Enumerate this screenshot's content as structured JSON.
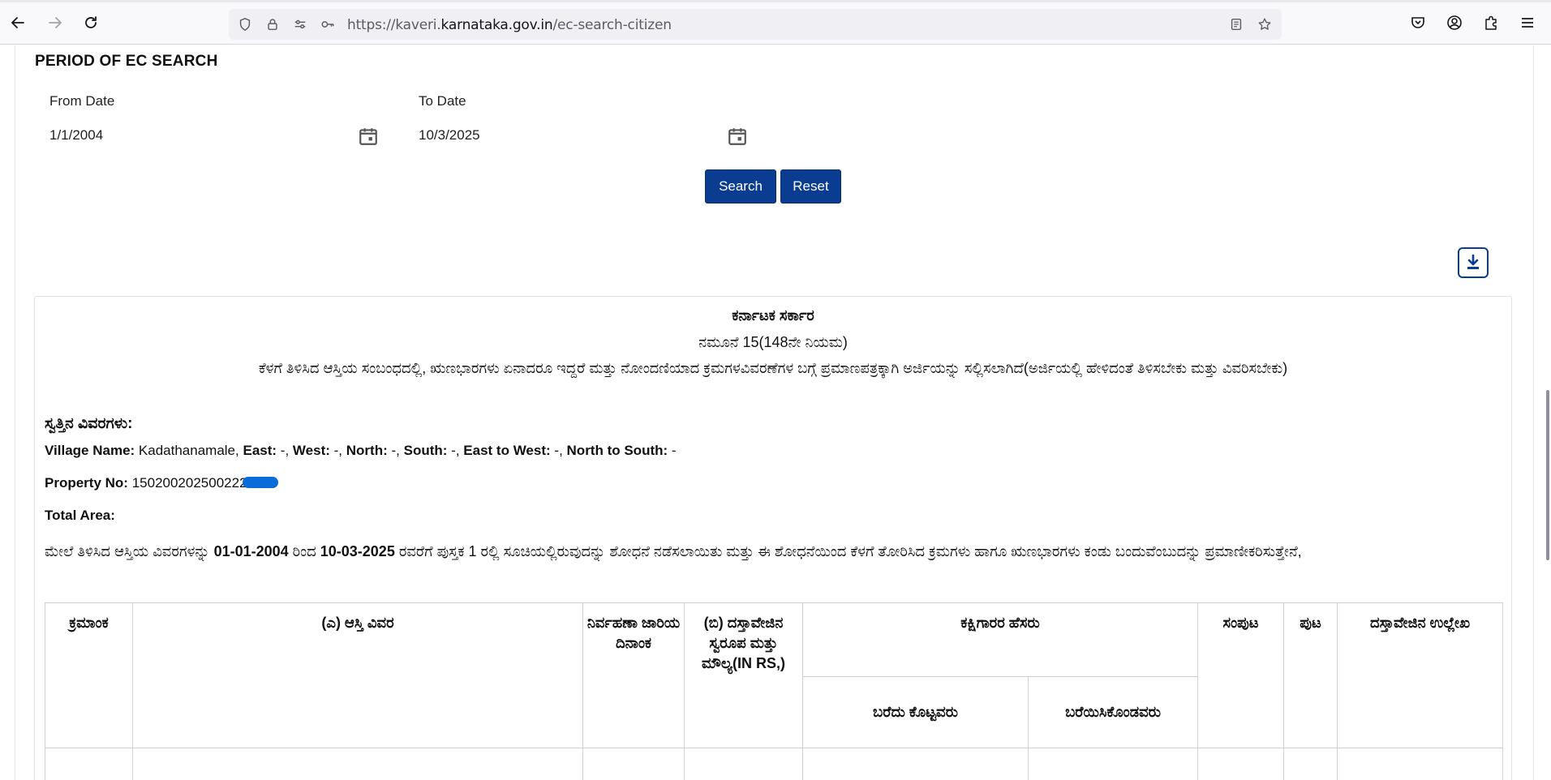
{
  "browser": {
    "url_prefix": "https://kaveri.",
    "url_host": "karnataka.gov.in",
    "url_path": "/ec-search-citizen"
  },
  "search": {
    "section_title": "PERIOD OF EC SEARCH",
    "from_label": "From Date",
    "from_value": "1/1/2004",
    "to_label": "To Date",
    "to_value": "10/3/2025",
    "search_label": "Search",
    "reset_label": "Reset"
  },
  "certificate": {
    "govt_title": "ಕರ್ನಾಟಕ ಸರ್ಕಾರ",
    "form_title": "ನಮೂನೆ 15(148ನೇ ನಿಯಮ)",
    "intro": "ಕೆಳಗೆ ತಿಳಿಸಿದ ಆಸ್ತಿಯ ಸಂಬಂಧದಲ್ಲಿ, ಋಣಭಾರಗಳು ಏನಾದರೂ ಇದ್ದರೆ ಮತ್ತು ನೋಂದಣಿಯಾದ ಕ್ರಮಗಳವಿವರಣೆಗಳ ಬಗ್ಗೆ ಪ್ರಮಾಣಪತ್ರಕ್ಕಾಗಿ ಅರ್ಜಿಯನ್ನು ಸಲ್ಲಿಸಲಾಗಿದೆ(ಅರ್ಜಿಯಲ್ಲಿ ಹೇಳಿದಂತೆ ತಿಳಿಸಬೇಕು ಮತ್ತು ವಿವರಿಸಬೇಕು)",
    "property_heading": "ಸ್ವತ್ತಿನ ವಿವರಗಳು:",
    "village_label": "Village Name:",
    "village_value": "Kadathanamale,",
    "east_label": "East:",
    "east_value": "-,",
    "west_label": "West:",
    "west_value": "-,",
    "north_label": "North:",
    "north_value": "-,",
    "south_label": "South:",
    "south_value": "-,",
    "ew_label": "East to West:",
    "ew_value": "-,",
    "ns_label": "North to South:",
    "ns_value": "-",
    "property_no_label": "Property No:",
    "property_no_value": "150200202500222",
    "total_area_label": "Total Area:",
    "para_part1": "ಮೇಲೆ ತಿಳಿಸಿದ ಆಸ್ತಿಯ ವಿವರಗಳನ್ನು ",
    "para_from": "01-01-2004",
    "para_part2": " ರಿಂದ ",
    "para_to": "10-03-2025",
    "para_part3": " ರವರೆಗೆ ಪುಸ್ತಕ 1 ರಲ್ಲಿ ಸೂಚಿಯಲ್ಲಿರುವುದನ್ನು ಶೋಧನೆ ನಡೆಸಲಾಯಿತು ಮತ್ತು ಈ ಶೋಧನೆಯಿಂದ ಕೆಳಗೆ ತೋರಿಸಿದ ಕ್ರಮಗಳು ಹಾಗೂ ಋಣಭಾರಗಳು ಕಂಡು ಬಂದುವೆಂಬುದನ್ನು ಪ್ರಮಾಣೀಕರಿಸುತ್ತೇನೆ,"
  },
  "table": {
    "col_serial": "ಕ್ರಮಾಂಕ",
    "col_property": "(ಎ) ಆಸ್ತಿ ವಿವರ",
    "col_exec_date": "ನಿರ್ವಹಣಾ ಜಾರಿಯ ದಿನಾಂಕ",
    "col_doc_nature": "(ಬಿ) ದಸ್ತಾವೇಜಿನ ಸ್ವರೂಪ ಮತ್ತು ಮೌಲ್ಯ(IN RS,)",
    "col_parties": "ಕಕ್ಷಿಗಾರರ ಹೆಸರು",
    "col_executant": "ಬರೆದು ಕೊಟ್ಟವರು",
    "col_claimant": "ಬರೆಯಿಸಿಕೊಂಡವರು",
    "col_volume": "ಸಂಪುಟ",
    "col_page": "ಪುಟ",
    "col_doc_ref": "ದಸ್ತಾವೇಜಿನ ಉಲ್ಲೇಖ"
  }
}
